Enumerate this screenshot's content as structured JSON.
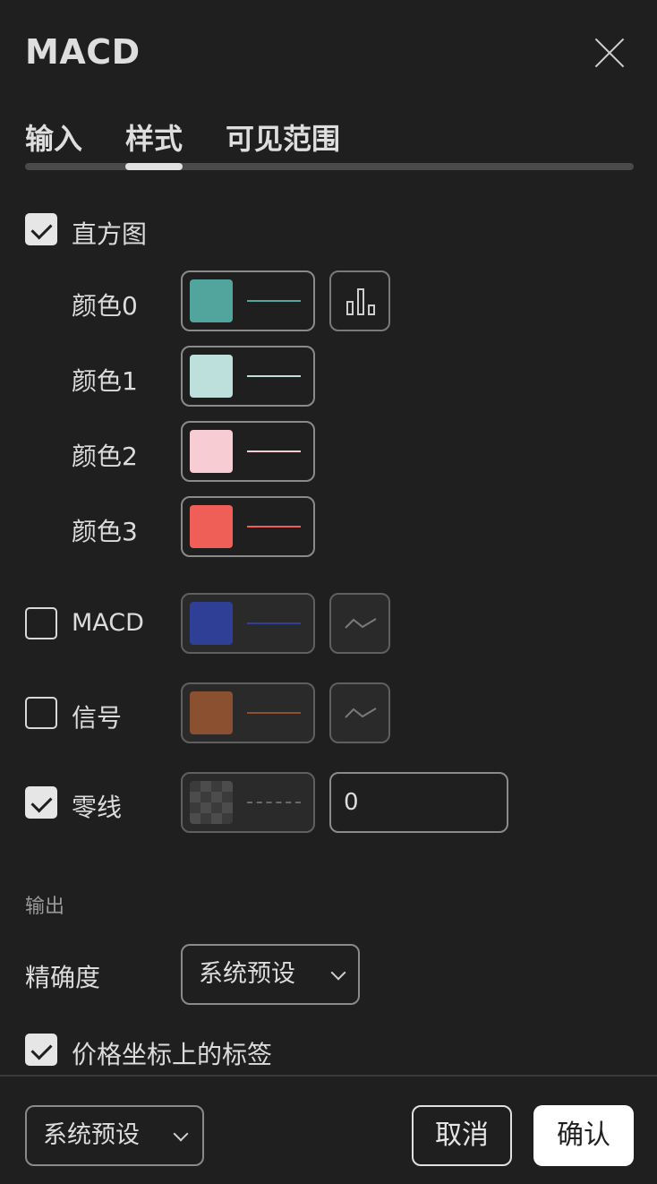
{
  "dialog": {
    "title": "MACD"
  },
  "tabs": [
    {
      "label": "输入",
      "active": false
    },
    {
      "label": "样式",
      "active": true
    },
    {
      "label": "可见范围",
      "active": false
    }
  ],
  "histogram": {
    "label": "直方图",
    "checked": true,
    "colors": [
      {
        "label": "颜色0",
        "color": "#52a59c"
      },
      {
        "label": "颜色1",
        "color": "#bde0dd"
      },
      {
        "label": "颜色2",
        "color": "#f8ccd3"
      },
      {
        "label": "颜色3",
        "color": "#ef5f58"
      }
    ],
    "style_icon": "bar-chart-icon"
  },
  "macd": {
    "label": "MACD",
    "checked": false,
    "color": "#2f3f96",
    "style_icon": "line-wave-icon"
  },
  "signal": {
    "label": "信号",
    "checked": false,
    "color": "#8b5030",
    "style_icon": "line-wave-icon"
  },
  "zero_line": {
    "label": "零线",
    "checked": true,
    "value": "0",
    "style": "dashed"
  },
  "output": {
    "section_label": "输出",
    "precision_label": "精确度",
    "precision_value": "系统预设",
    "price_scale_label": "价格坐标上的标签",
    "price_scale_checked": true
  },
  "footer": {
    "defaults_value": "系统预设",
    "cancel_label": "取消",
    "ok_label": "确认"
  },
  "colors": {
    "background": "#1f1f1f",
    "text": "#dcdcdc",
    "accent": "#ffffff"
  }
}
